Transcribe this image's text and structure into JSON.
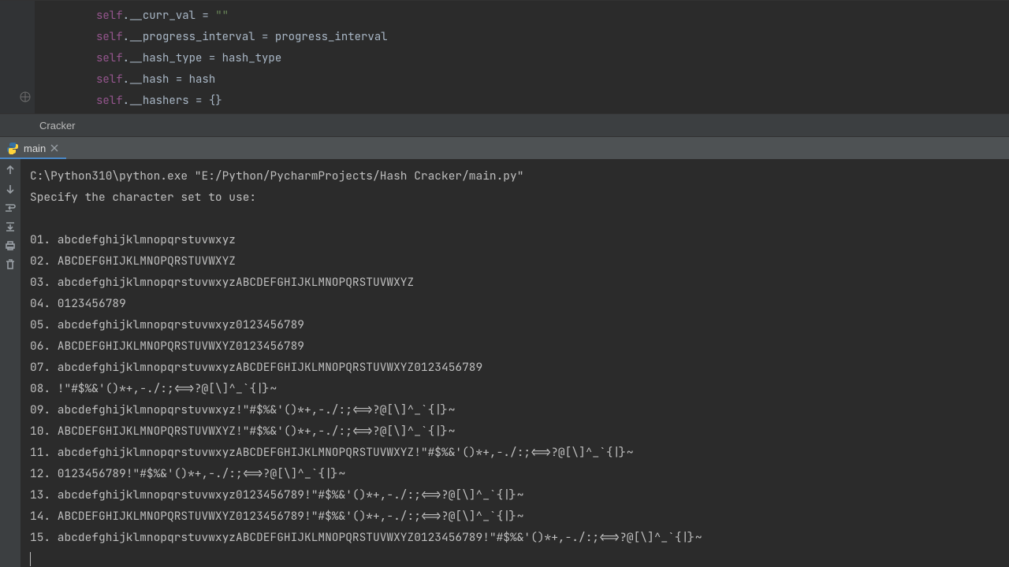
{
  "editor": {
    "lines": [
      [
        [
          "self",
          "kw-self"
        ],
        [
          ".",
          "punct"
        ],
        [
          "__curr_val = ",
          "ident"
        ],
        [
          "\"\"",
          "str"
        ]
      ],
      [
        [
          "self",
          "kw-self"
        ],
        [
          ".",
          "punct"
        ],
        [
          "__progress_interval = progress_interval",
          "ident"
        ]
      ],
      [
        [
          "self",
          "kw-self"
        ],
        [
          ".",
          "punct"
        ],
        [
          "__hash_type = hash_type",
          "ident"
        ]
      ],
      [
        [
          "self",
          "kw-self"
        ],
        [
          ".",
          "punct"
        ],
        [
          "__hash = hash",
          "ident"
        ]
      ],
      [
        [
          "self",
          "kw-self"
        ],
        [
          ".",
          "punct"
        ],
        [
          "__hashers = {}",
          "ident"
        ]
      ]
    ]
  },
  "breadcrumb": {
    "path": "Cracker"
  },
  "run_tab": {
    "label": "main"
  },
  "console": {
    "cmd": "C:\\Python310\\python.exe \"E:/Python/PycharmProjects/Hash Cracker/main.py\"",
    "prompt": "Specify the character set to use:",
    "options": [
      "01. abcdefghijklmnopqrstuvwxyz",
      "02. ABCDEFGHIJKLMNOPQRSTUVWXYZ",
      "03. abcdefghijklmnopqrstuvwxyzABCDEFGHIJKLMNOPQRSTUVWXYZ",
      "04. 0123456789",
      "05. abcdefghijklmnopqrstuvwxyz0123456789",
      "06. ABCDEFGHIJKLMNOPQRSTUVWXYZ0123456789",
      "07. abcdefghijklmnopqrstuvwxyzABCDEFGHIJKLMNOPQRSTUVWXYZ0123456789",
      "08. !\"#$%&'()*+,-./:;<=>?@[\\]^_`{|}~",
      "09. abcdefghijklmnopqrstuvwxyz!\"#$%&'()*+,-./:;<=>?@[\\]^_`{|}~",
      "10. ABCDEFGHIJKLMNOPQRSTUVWXYZ!\"#$%&'()*+,-./:;<=>?@[\\]^_`{|}~",
      "11. abcdefghijklmnopqrstuvwxyzABCDEFGHIJKLMNOPQRSTUVWXYZ!\"#$%&'()*+,-./:;<=>?@[\\]^_`{|}~",
      "12. 0123456789!\"#$%&'()*+,-./:;<=>?@[\\]^_`{|}~",
      "13. abcdefghijklmnopqrstuvwxyz0123456789!\"#$%&'()*+,-./:;<=>?@[\\]^_`{|}~",
      "14. ABCDEFGHIJKLMNOPQRSTUVWXYZ0123456789!\"#$%&'()*+,-./:;<=>?@[\\]^_`{|}~",
      "15. abcdefghijklmnopqrstuvwxyzABCDEFGHIJKLMNOPQRSTUVWXYZ0123456789!\"#$%&'()*+,-./:;<=>?@[\\]^_`{|}~"
    ]
  }
}
